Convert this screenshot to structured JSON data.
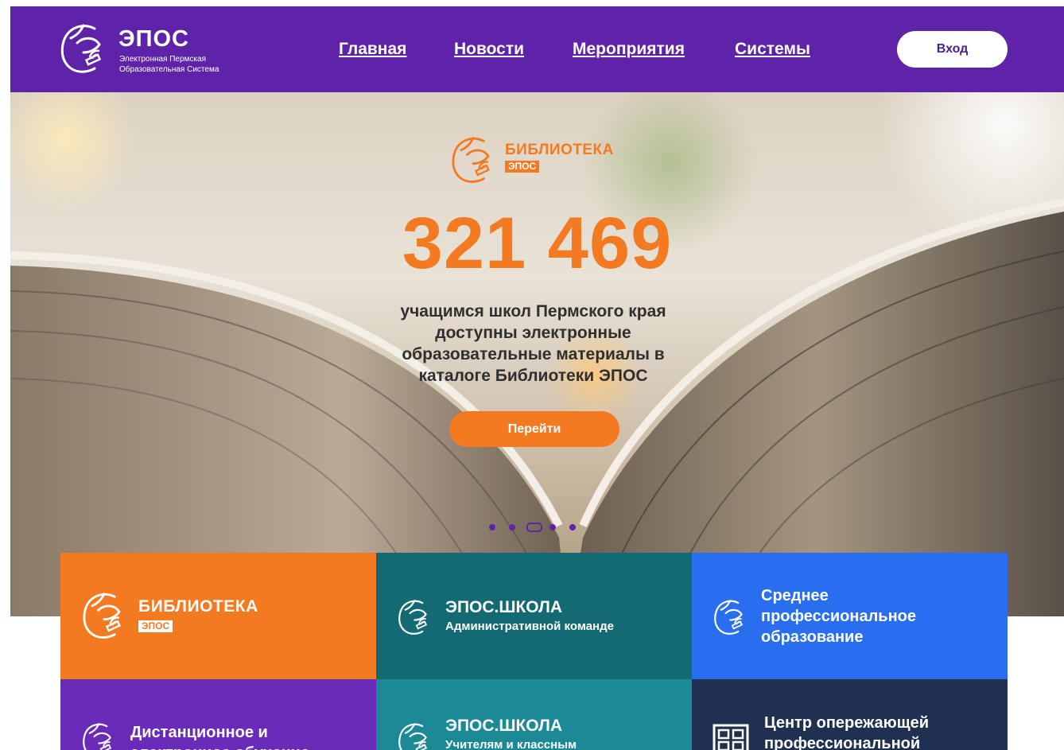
{
  "header": {
    "logo": {
      "title": "ЭПОС",
      "subtitle_line1": "Электронная Пермская",
      "subtitle_line2": "Образовательная Система"
    },
    "nav": [
      {
        "label": "Главная"
      },
      {
        "label": "Новости"
      },
      {
        "label": "Мероприятия"
      },
      {
        "label": "Системы"
      }
    ],
    "login_label": "Вход"
  },
  "hero": {
    "library_logo": {
      "title": "БИБЛИОТЕКА",
      "badge": "ЭПОС"
    },
    "counter": "321 469",
    "description_lines": [
      "учащимся школ Пермского края",
      "доступны электронные",
      "образовательные материалы  в",
      "каталоге Библиотеки ЭПОС"
    ],
    "cta_label": "Перейти",
    "carousel": {
      "total": 5,
      "active_index": 2
    }
  },
  "tiles": [
    {
      "title": "БИБЛИОТЕКА",
      "badge": "ЭПОС",
      "color": "#f47a22",
      "icon": "bear-logo-icon"
    },
    {
      "title": "ЭПОС.ШКОЛА",
      "subtitle": "Административной команде",
      "color": "#136a73",
      "icon": "bear-logo-icon"
    },
    {
      "title_lines": [
        "Среднее",
        "профессиональное",
        "образование"
      ],
      "color": "#2a6ef0",
      "icon": "bear-logo-icon"
    },
    {
      "title_lines": [
        "Дистанционное и",
        "электронное обучение"
      ],
      "color": "#6a2bb8",
      "icon": "bear-logo-icon"
    },
    {
      "title": "ЭПОС.ШКОЛА",
      "subtitle": "Учителям и классным",
      "color": "#1b8a96",
      "icon": "bear-logo-icon"
    },
    {
      "title_lines": [
        "Центр опережающей",
        "профессиональной"
      ],
      "color": "#1f3050",
      "icon": "grid-building-icon"
    }
  ],
  "colors": {
    "header_bg": "#5e23a8",
    "accent_orange": "#f47a22",
    "white": "#ffffff"
  }
}
